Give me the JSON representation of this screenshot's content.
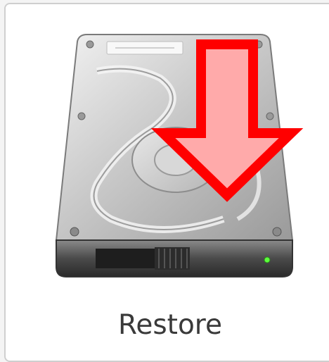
{
  "tile": {
    "label": "Restore",
    "icon": "hard-drive-restore-icon",
    "arrow_color": "#ff0000",
    "arrow_fill": "#ffaaaa"
  }
}
